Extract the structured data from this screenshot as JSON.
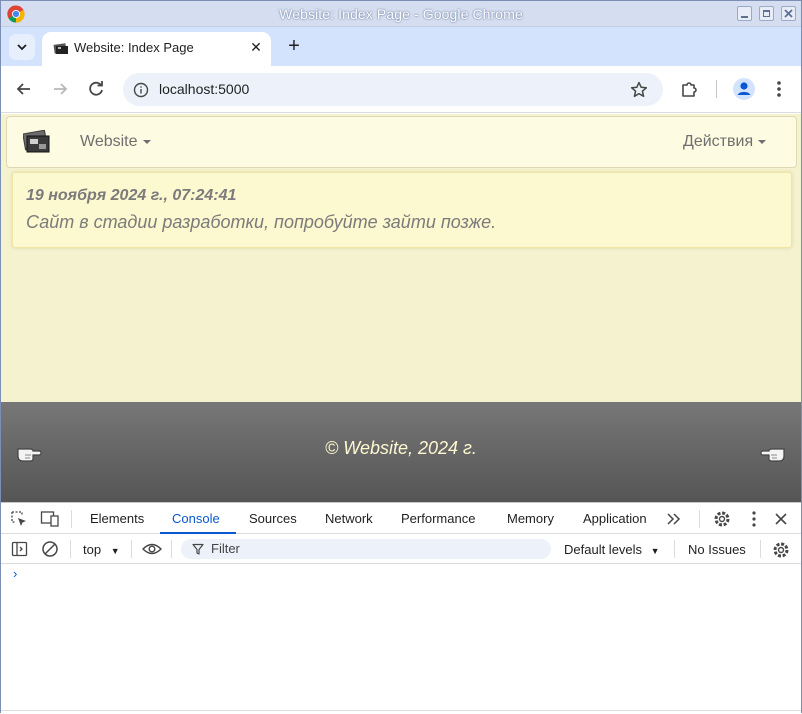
{
  "window": {
    "title": "Website: Index Page - Google Chrome"
  },
  "tab": {
    "title": "Website: Index Page",
    "close": "✕",
    "new_tab": "+"
  },
  "omnibox": {
    "url": "localhost:5000"
  },
  "page": {
    "navbar": {
      "brand_menu": "Website",
      "actions_menu": "Действия"
    },
    "alert": {
      "date": "19 ноября 2024 г., 07:24:41",
      "message": "Сайт в стадии разработки, попробуйте зайти позже."
    },
    "footer": {
      "copyright": "© Website, 2024 г."
    }
  },
  "devtools": {
    "tabs": [
      "Elements",
      "Console",
      "Sources",
      "Network",
      "Performance",
      "Memory",
      "Application"
    ],
    "active_tab": "Console",
    "context": "top",
    "filter_placeholder": "Filter",
    "levels": "Default levels",
    "issues": "No Issues",
    "prompt": "›"
  },
  "colors": {
    "page_bg": "#f5f2d0",
    "alert_bg": "#fcf8cf",
    "accent": "#0b57d0"
  }
}
